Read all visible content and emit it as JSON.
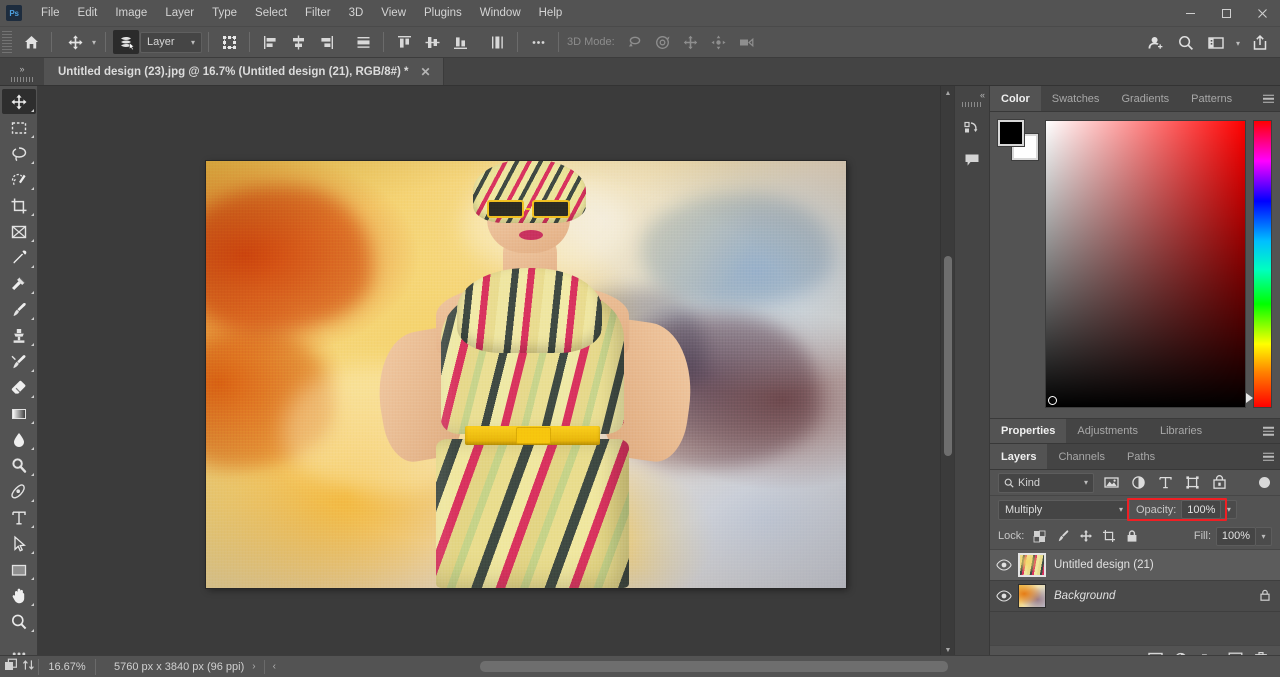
{
  "app": {
    "name": "Adobe Photoshop",
    "logo_text": "Ps"
  },
  "menubar": {
    "items": [
      {
        "label": "File"
      },
      {
        "label": "Edit"
      },
      {
        "label": "Image"
      },
      {
        "label": "Layer"
      },
      {
        "label": "Type"
      },
      {
        "label": "Select"
      },
      {
        "label": "Filter"
      },
      {
        "label": "3D"
      },
      {
        "label": "View"
      },
      {
        "label": "Plugins"
      },
      {
        "label": "Window"
      },
      {
        "label": "Help"
      }
    ],
    "window_controls": [
      {
        "name": "minimize",
        "glyph": "—"
      },
      {
        "name": "maximize",
        "glyph": "❐"
      },
      {
        "name": "close",
        "glyph": "✕"
      }
    ]
  },
  "options_bar": {
    "home_icon": "home-icon",
    "tool_icon": "move-tool-icon",
    "auto_select_icon": "auto-select-layers-icon",
    "layer_select": {
      "value": "Layer"
    },
    "transform_controls_icon": "show-transform-controls-icon",
    "align_left_icon": "align-left-edges-icon",
    "align_hcenter_icon": "align-horizontal-centers-icon",
    "align_right_icon": "align-right-edges-icon",
    "distribute_h_icon": "distribute-horizontally-icon",
    "align_top_icon": "align-top-edges-icon",
    "align_vcenter_icon": "align-vertical-centers-icon",
    "align_bottom_icon": "align-bottom-edges-icon",
    "distribute_v_icon": "distribute-vertically-icon",
    "more_icon": "more-options-icon",
    "mode_3d_label": "3D Mode:",
    "mode_3d_icons": [
      "rotate-3d-icon",
      "roll-3d-icon",
      "drag-3d-icon",
      "slide-3d-icon",
      "scale-3d-camera-icon"
    ],
    "right_icons": [
      "share-user-icon",
      "search-icon",
      "workspace-switcher-icon",
      "share-export-icon"
    ]
  },
  "tabbar": {
    "collapse_label": "»",
    "document": {
      "title": "Untitled design (23).jpg @ 16.7% (Untitled design (21), RGB/8#) *",
      "close_glyph": "✕"
    }
  },
  "toolbar": {
    "tools": [
      {
        "name": "move-tool",
        "active": true
      },
      {
        "name": "rectangular-marquee-tool",
        "active": false
      },
      {
        "name": "lasso-tool",
        "active": false
      },
      {
        "name": "object-selection-tool",
        "active": false
      },
      {
        "name": "crop-tool",
        "active": false
      },
      {
        "name": "frame-tool",
        "active": false
      },
      {
        "name": "eyedropper-tool",
        "active": false
      },
      {
        "name": "spot-healing-brush-tool",
        "active": false
      },
      {
        "name": "brush-tool",
        "active": false
      },
      {
        "name": "clone-stamp-tool",
        "active": false
      },
      {
        "name": "history-brush-tool",
        "active": false
      },
      {
        "name": "eraser-tool",
        "active": false
      },
      {
        "name": "gradient-tool",
        "active": false
      },
      {
        "name": "blur-tool",
        "active": false
      },
      {
        "name": "dodge-tool",
        "active": false
      },
      {
        "name": "pen-tool",
        "active": false
      },
      {
        "name": "horizontal-type-tool",
        "active": false
      },
      {
        "name": "path-selection-tool",
        "active": false
      },
      {
        "name": "rectangle-tool",
        "active": false
      },
      {
        "name": "hand-tool",
        "active": false
      },
      {
        "name": "zoom-tool",
        "active": false
      },
      {
        "name": "edit-toolbar",
        "active": false
      }
    ]
  },
  "canvas": {
    "artwork_description": "Fashion portrait of a woman in a yellow and pink striped dress with yellow belt, striped headwrap and yellow sunglasses, over an orange-to-blue watercolor wash background"
  },
  "dock_rail": {
    "icons": [
      {
        "name": "history-panel-icon"
      },
      {
        "name": "comments-panel-icon"
      }
    ],
    "collapse_glyph": "«"
  },
  "color_panel": {
    "tabs": [
      {
        "label": "Color",
        "active": true
      },
      {
        "label": "Swatches",
        "active": false
      },
      {
        "label": "Gradients",
        "active": false
      },
      {
        "label": "Patterns",
        "active": false
      }
    ],
    "foreground_color": "#000000",
    "background_color": "#ffffff",
    "picker_hue": "#ff0000",
    "menu_icon": "panel-menu-icon"
  },
  "properties_panel": {
    "tabs": [
      {
        "label": "Properties",
        "active": true
      },
      {
        "label": "Adjustments",
        "active": false
      },
      {
        "label": "Libraries",
        "active": false
      }
    ],
    "menu_icon": "panel-menu-icon"
  },
  "layers_panel": {
    "tabs": [
      {
        "label": "Layers",
        "active": true
      },
      {
        "label": "Channels",
        "active": false
      },
      {
        "label": "Paths",
        "active": false
      }
    ],
    "menu_icon": "panel-menu-icon",
    "filter": {
      "kind_label": "Kind",
      "search_icon": "search-icon",
      "type_filters": [
        {
          "name": "filter-pixel-layers-icon"
        },
        {
          "name": "filter-adjustment-layers-icon"
        },
        {
          "name": "filter-type-layers-icon"
        },
        {
          "name": "filter-shape-layers-icon"
        },
        {
          "name": "filter-smart-object-layers-icon"
        }
      ],
      "toggle_name": "filter-enable-toggle"
    },
    "blend_mode": "Multiply",
    "opacity_label": "Opacity:",
    "opacity_value": "100%",
    "fill_label": "Fill:",
    "fill_value": "100%",
    "lock_label": "Lock:",
    "lock_icons": [
      {
        "name": "lock-transparent-pixels-icon"
      },
      {
        "name": "lock-image-pixels-icon"
      },
      {
        "name": "lock-position-icon"
      },
      {
        "name": "lock-artboard-nesting-icon"
      },
      {
        "name": "lock-all-icon"
      }
    ],
    "highlight_color": "#f01f24",
    "layers": [
      {
        "name": "Untitled design (21)",
        "visible": true,
        "selected": true,
        "locked": false,
        "italic": false,
        "thumb": "striped-dress-thumbnail"
      },
      {
        "name": "Background",
        "visible": true,
        "selected": false,
        "locked": true,
        "italic": true,
        "thumb": "watercolor-background-thumbnail"
      }
    ],
    "footer_icons": [
      {
        "name": "link-layers-icon"
      },
      {
        "name": "layer-style-fx-icon"
      },
      {
        "name": "add-layer-mask-icon"
      },
      {
        "name": "new-adjustment-layer-icon"
      },
      {
        "name": "new-group-icon"
      },
      {
        "name": "new-layer-icon"
      },
      {
        "name": "delete-layer-icon"
      }
    ]
  },
  "statusbar": {
    "zoom_level": "16.67%",
    "doc_info": "5760 px x 3840 px (96 ppi)",
    "next_glyph": "›",
    "prev_glyph": "‹",
    "icons": [
      {
        "name": "screen-mode-icon"
      },
      {
        "name": "arrange-documents-icon"
      }
    ]
  }
}
